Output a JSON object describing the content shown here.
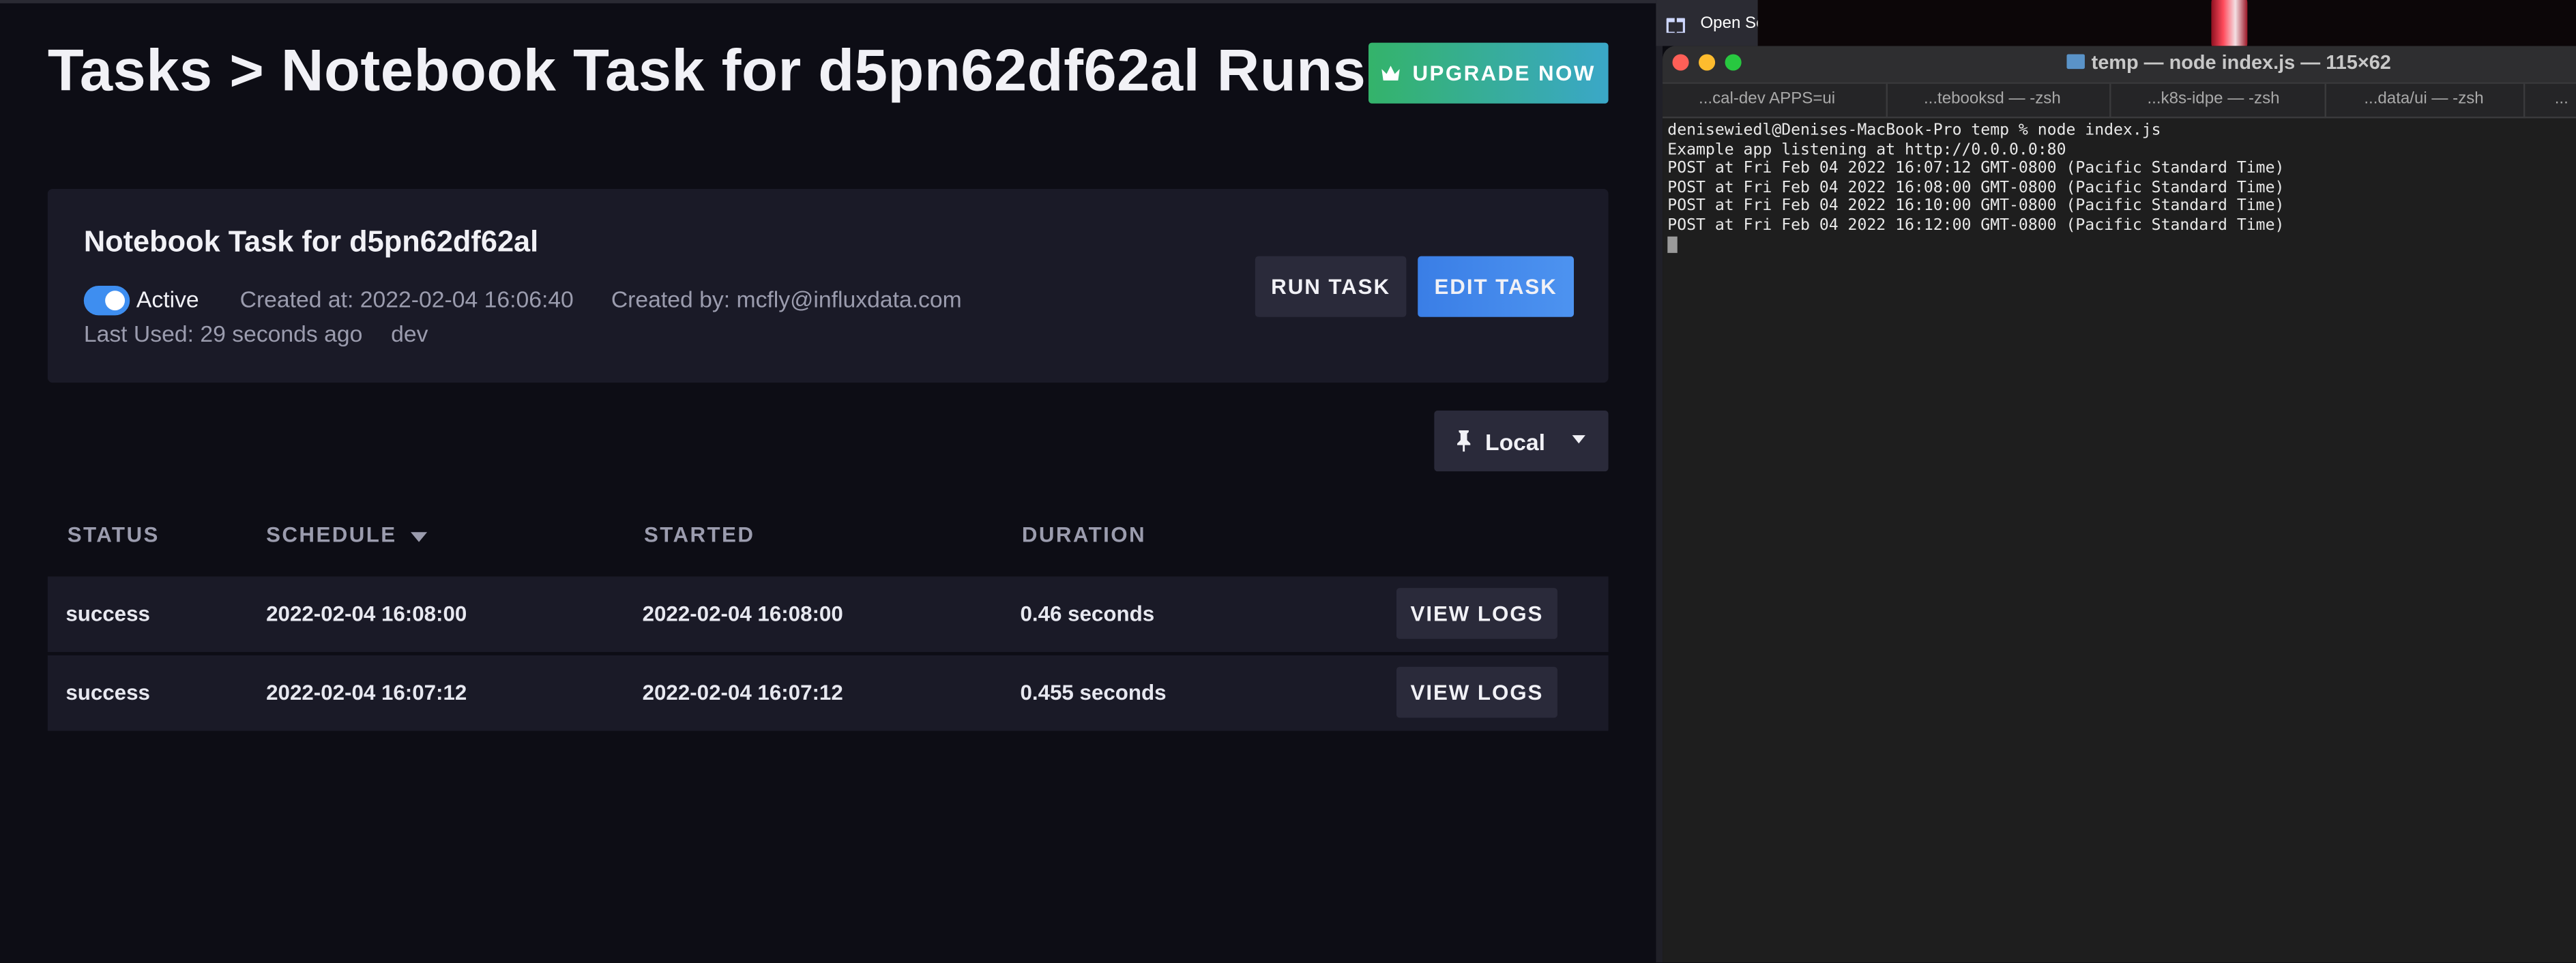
{
  "page": {
    "title": "Tasks > Notebook Task for d5pn62df62al Runs",
    "upgrade_label": "UPGRADE NOW",
    "accent_upgrade": "#34b36a",
    "accent_primary": "#3e8ef0"
  },
  "task": {
    "name": "Notebook Task for d5pn62df62al",
    "status_label": "Active",
    "active": true,
    "created_at": "Created at: 2022-02-04 16:06:40",
    "created_by": "Created by: mcfly@influxdata.com",
    "last_used": "Last Used: 29 seconds ago",
    "label": "dev",
    "run_label": "RUN TASK",
    "edit_label": "EDIT TASK"
  },
  "filter": {
    "selected": "Local"
  },
  "table": {
    "headers": {
      "status": "STATUS",
      "schedule": "SCHEDULE",
      "started": "STARTED",
      "duration": "DURATION"
    },
    "sort_column": "schedule",
    "sort_direction": "descending",
    "rows": [
      {
        "status": "success",
        "schedule": "2022-02-04 16:08:00",
        "started": "2022-02-04 16:08:00",
        "duration": "0.46 seconds",
        "action": "VIEW LOGS"
      },
      {
        "status": "success",
        "schedule": "2022-02-04 16:07:12",
        "started": "2022-02-04 16:07:12",
        "duration": "0.455 seconds",
        "action": "VIEW LOGS"
      }
    ]
  },
  "taskbar": {
    "open_label": "Open Se"
  },
  "terminal": {
    "title": "temp — node index.js — 115×62",
    "tabs": [
      "...cal-dev APPS=ui",
      "...tebooksd — -zsh",
      "...k8s-idpe — -zsh",
      "...data/ui — -zsh",
      "..."
    ],
    "lines": [
      "denisewiedl@Denises-MacBook-Pro temp % node index.js",
      "Example app listening at http://0.0.0.0:80",
      "POST at Fri Feb 04 2022 16:07:12 GMT-0800 (Pacific Standard Time)",
      "POST at Fri Feb 04 2022 16:08:00 GMT-0800 (Pacific Standard Time)",
      "POST at Fri Feb 04 2022 16:10:00 GMT-0800 (Pacific Standard Time)",
      "POST at Fri Feb 04 2022 16:12:00 GMT-0800 (Pacific Standard Time)"
    ]
  },
  "icons": {
    "upgrade": "crown-icon",
    "filter": "pin-icon",
    "dropdown": "chevron-down-icon",
    "sort": "sort-desc-icon",
    "taskbar": "gift-icon",
    "terminal_folder": "folder-icon"
  }
}
